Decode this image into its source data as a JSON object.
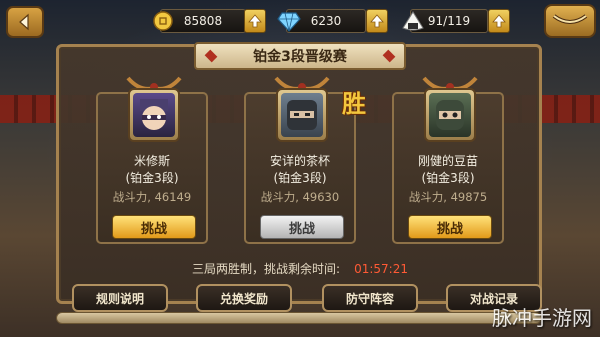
{
  "resources": {
    "gold": "85808",
    "diamond": "6230",
    "rice": "91/119"
  },
  "title": "铂金3段晋级赛",
  "win_mark": "胜",
  "opponents": [
    {
      "name": "米修斯",
      "rank": "(铂金3段)",
      "power": "战斗力, 46149",
      "button": "挑战"
    },
    {
      "name": "安详的茶杯",
      "rank": "(铂金3段)",
      "power": "战斗力, 49630",
      "button": "挑战"
    },
    {
      "name": "刚健的豆苗",
      "rank": "(铂金3段)",
      "power": "战斗力, 49875",
      "button": "挑战"
    }
  ],
  "timer": {
    "label": "三局两胜制，挑战剩余时间:",
    "value": "01:57:21"
  },
  "bottom_buttons": [
    "规则说明",
    "兑换奖励",
    "防守阵容",
    "对战记录"
  ],
  "watermark": "脉冲手游网",
  "colors": {
    "gold_button": "#f2b537",
    "gray_button": "#cfcfcf",
    "timer": "#ff5a35",
    "win": "#f3c63d"
  }
}
